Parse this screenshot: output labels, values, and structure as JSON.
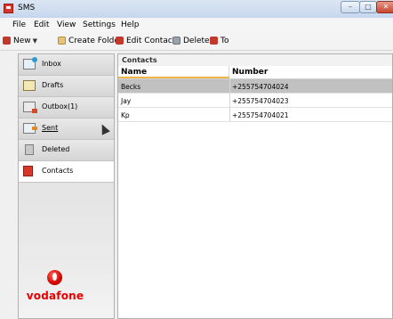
{
  "window": {
    "title": "SMS"
  },
  "menu": [
    "File",
    "Edit",
    "View",
    "Settings",
    "Help"
  ],
  "toolbar": {
    "new": "New",
    "create_folder": "Create Folder",
    "edit_contact": "Edit Contact",
    "delete": "Delete",
    "to": "To"
  },
  "sidebar": {
    "items": [
      {
        "label": "Inbox",
        "icon": "inbox-icon"
      },
      {
        "label": "Drafts",
        "icon": "drafts-icon"
      },
      {
        "label": "Outbox(1)",
        "icon": "outbox-icon"
      },
      {
        "label": "Sent",
        "icon": "sent-icon"
      },
      {
        "label": "Deleted",
        "icon": "trash-icon"
      },
      {
        "label": "Contacts",
        "icon": "contacts-icon",
        "active": true
      }
    ],
    "logo_text": "vodafone"
  },
  "contacts": {
    "title": "Contacts",
    "columns": [
      "Name",
      "Number"
    ],
    "rows": [
      {
        "name": "Becks",
        "number": "+255754704024",
        "selected": true
      },
      {
        "name": "Jay",
        "number": "+255754704023"
      },
      {
        "name": "Kp",
        "number": "+255754704021"
      }
    ]
  },
  "colors": {
    "accent": "#f1b545",
    "brand": "#e60000",
    "selected_row": "#c1c1c1"
  }
}
